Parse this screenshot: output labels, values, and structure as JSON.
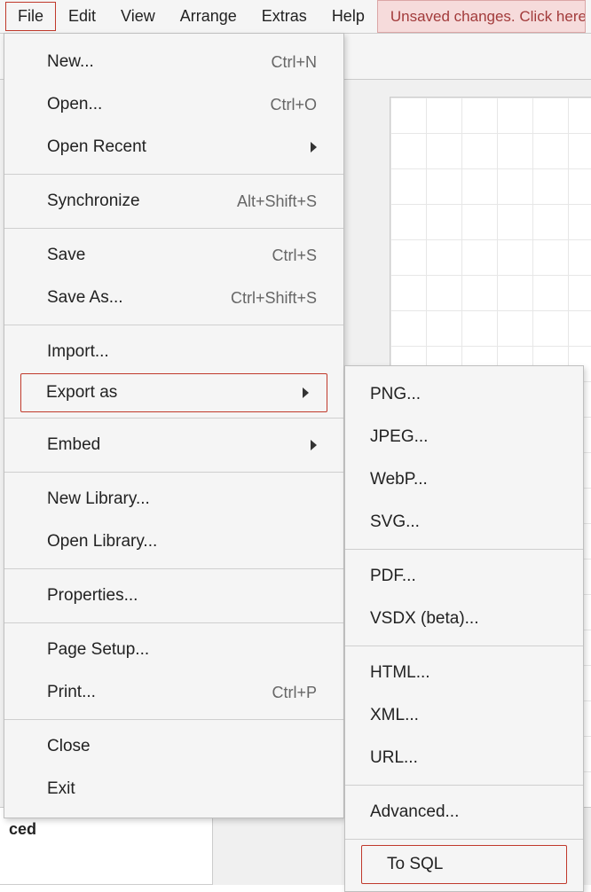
{
  "menubar": {
    "file": "File",
    "edit": "Edit",
    "view": "View",
    "arrange": "Arrange",
    "extras": "Extras",
    "help": "Help"
  },
  "warning_banner": "Unsaved changes. Click here",
  "panel_stub_label": "ced",
  "file_menu": {
    "new": {
      "label": "New...",
      "shortcut": "Ctrl+N"
    },
    "open": {
      "label": "Open...",
      "shortcut": "Ctrl+O"
    },
    "open_recent": {
      "label": "Open Recent"
    },
    "synchronize": {
      "label": "Synchronize",
      "shortcut": "Alt+Shift+S"
    },
    "save": {
      "label": "Save",
      "shortcut": "Ctrl+S"
    },
    "save_as": {
      "label": "Save As...",
      "shortcut": "Ctrl+Shift+S"
    },
    "import": {
      "label": "Import..."
    },
    "export_as": {
      "label": "Export as"
    },
    "embed": {
      "label": "Embed"
    },
    "new_library": {
      "label": "New Library..."
    },
    "open_library": {
      "label": "Open Library..."
    },
    "properties": {
      "label": "Properties..."
    },
    "page_setup": {
      "label": "Page Setup..."
    },
    "print": {
      "label": "Print...",
      "shortcut": "Ctrl+P"
    },
    "close": {
      "label": "Close"
    },
    "exit": {
      "label": "Exit"
    }
  },
  "export_submenu": {
    "png": "PNG...",
    "jpeg": "JPEG...",
    "webp": "WebP...",
    "svg": "SVG...",
    "pdf": "PDF...",
    "vsdx": "VSDX (beta)...",
    "html": "HTML...",
    "xml": "XML...",
    "url": "URL...",
    "advanced": "Advanced...",
    "to_sql": "To SQL"
  }
}
